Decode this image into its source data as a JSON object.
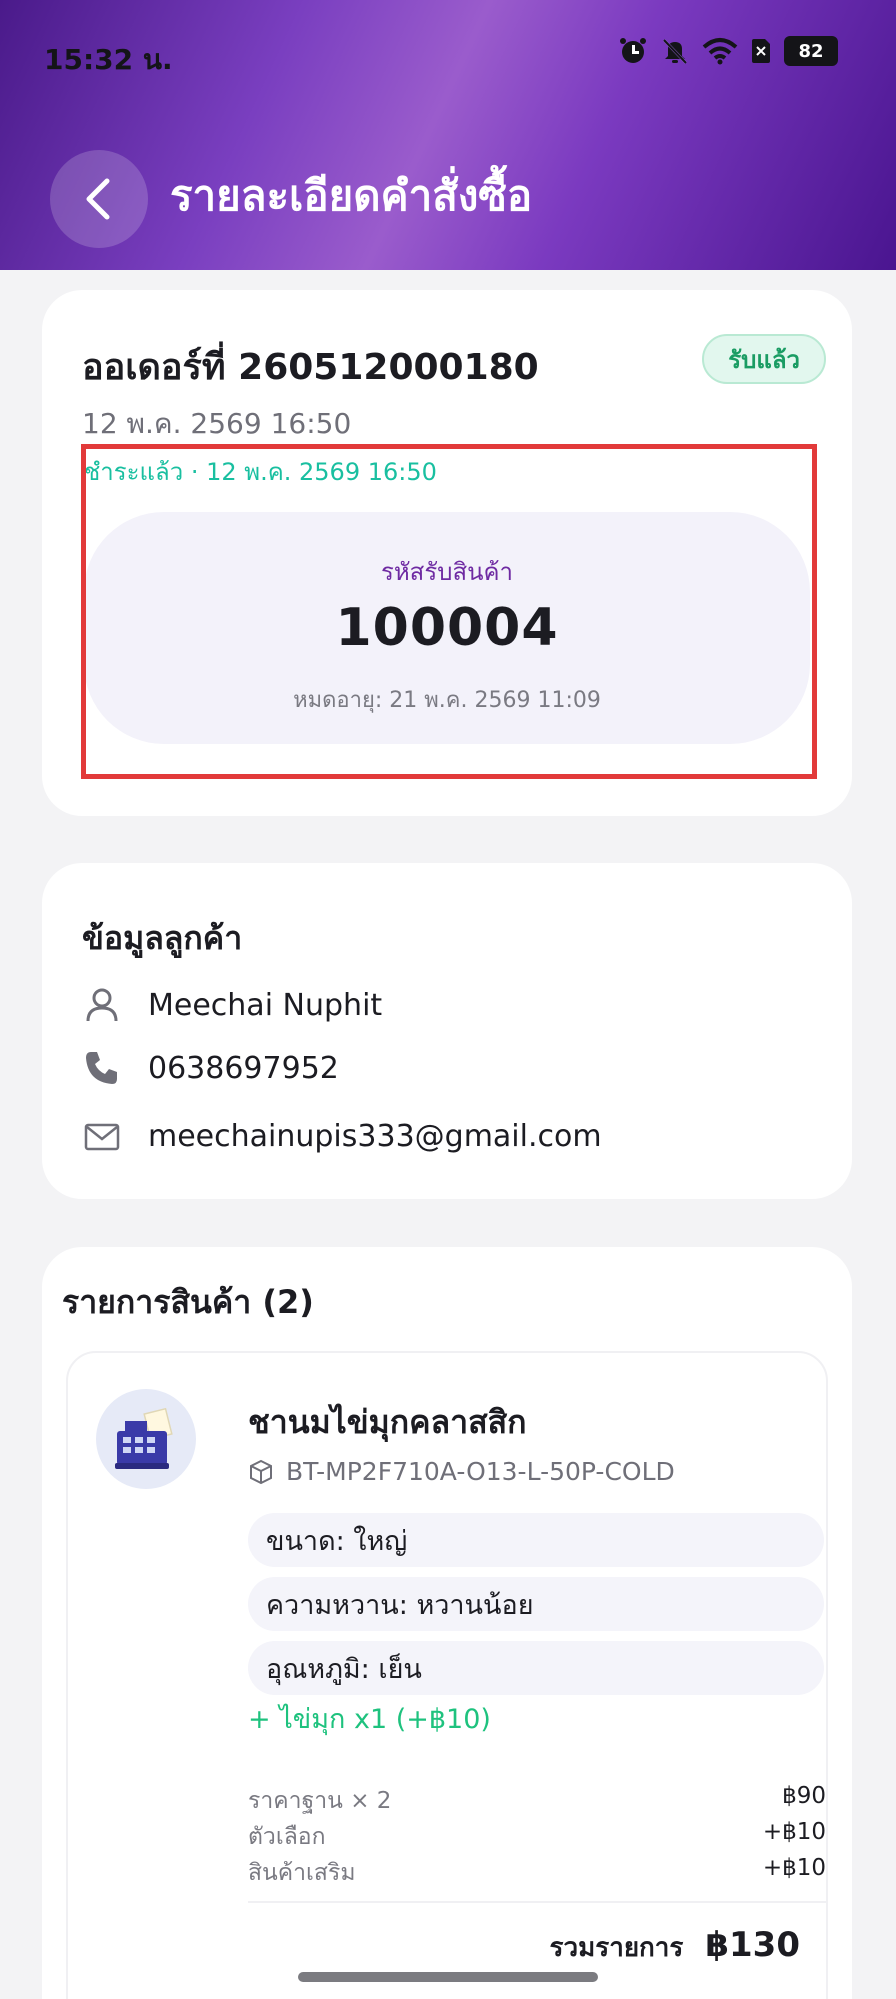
{
  "status_bar": {
    "time": "15:32 น.",
    "battery": "82"
  },
  "header": {
    "title": "รายละเอียดคำสั่งซื้อ"
  },
  "order": {
    "title": "ออเดอร์ที่ 260512000180",
    "status": "รับแล้ว",
    "date": "12 พ.ค. 2569 16:50",
    "paid": "ชำระแล้ว · 12 พ.ค. 2569 16:50",
    "pickup_label": "รหัสรับสินค้า",
    "pickup_code": "100004",
    "pickup_expiry": "หมดอายุ: 21 พ.ค. 2569 11:09"
  },
  "customer": {
    "title": "ข้อมูลลูกค้า",
    "name": "Meechai Nuphit",
    "phone": "0638697952",
    "email": "meechainupis333@gmail.com"
  },
  "items": {
    "title": "รายการสินค้า (2)",
    "list": [
      {
        "name": "ชานมไข่มุกคลาสสิก",
        "sku": "BT-MP2F710A-O13-L-50P-COLD",
        "options": [
          "ขนาด: ใหญ่",
          "ความหวาน: หวานน้อย",
          "อุณหภูมิ: เย็น"
        ],
        "addon": "+ ไข่มุก x1 (+฿10)",
        "price_rows": [
          {
            "label": "ราคาฐาน × 2",
            "value": "฿90"
          },
          {
            "label": "ตัวเลือก",
            "value": "+฿10"
          },
          {
            "label": "สินค้าเสริม",
            "value": "+฿10"
          }
        ],
        "subtotal_label": "รวมรายการ",
        "subtotal_value": "฿130"
      }
    ]
  },
  "colors": {
    "accent": "#7a3fc0",
    "status_green": "#1a9c63",
    "paid_teal": "#19bfa0",
    "highlight": "#e23a3a"
  }
}
